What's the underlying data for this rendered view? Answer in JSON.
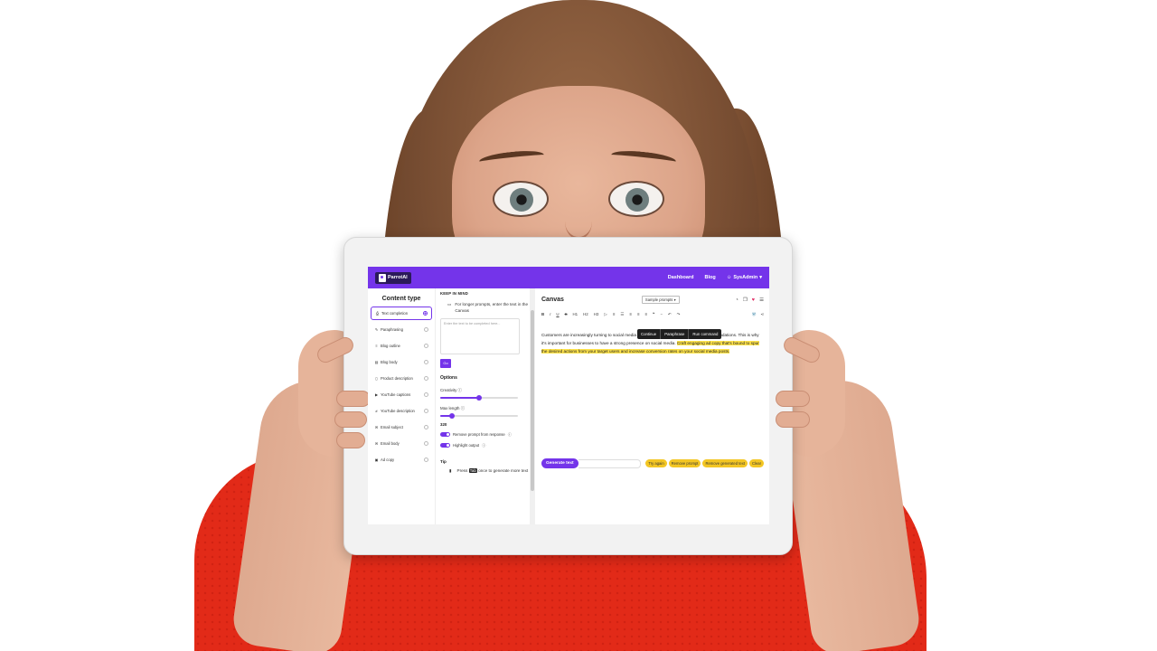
{
  "app": {
    "name": "ParrotAI"
  },
  "nav": {
    "dashboard": "Dashboard",
    "blog": "Blog",
    "user": "SysAdmin"
  },
  "sidebar": {
    "title": "Content type",
    "items": [
      {
        "label": "Text completion",
        "icon": "printer-icon",
        "selected": true
      },
      {
        "label": "Paraphrasing",
        "icon": "edit-icon",
        "selected": false
      },
      {
        "label": "Blog outline",
        "icon": "list-icon",
        "selected": false
      },
      {
        "label": "Blog body",
        "icon": "document-icon",
        "selected": false
      },
      {
        "label": "Product description",
        "icon": "phone-icon",
        "selected": false
      },
      {
        "label": "YouTube captions",
        "icon": "youtube-icon",
        "selected": false
      },
      {
        "label": "YouTube description",
        "icon": "tag-icon",
        "selected": false
      },
      {
        "label": "Email subject",
        "icon": "email-icon",
        "selected": false
      },
      {
        "label": "Email body",
        "icon": "email-icon",
        "selected": false
      },
      {
        "label": "Ad copy",
        "icon": "ad-icon",
        "selected": false
      }
    ]
  },
  "prompt_panel": {
    "keep_in_mind": "KEEP IN MIND",
    "note": "For longer prompts, enter the text in the Canvas",
    "placeholder": "Enter the text to be completed here...",
    "go": "Go",
    "options_title": "Options",
    "creativity_label": "Creativity",
    "creativity_level": 0.5,
    "max_length_label": "Max length",
    "max_length_value": "320",
    "max_length_level": 0.15,
    "toggle_remove_prompt": "Remove prompt from response",
    "toggle_highlight": "Highlight output",
    "tip_title": "Tip",
    "tip_pre": "Press",
    "tip_key": "Tab",
    "tip_post": "once to generate more text"
  },
  "canvas": {
    "title": "Canvas",
    "sample_prompts": "Sample prompts",
    "toolbar": [
      "B",
      "I",
      "U",
      "S",
      "H1",
      "H2",
      "H3",
      "▷",
      "≡",
      "☰",
      "≡",
      "≡",
      "≡",
      "❝",
      "−",
      "↶",
      "↷"
    ],
    "text_plain": "Customers are increasingly turning to social media for their purchasing decisions and recommendations. This is why it's important for businesses to have a strong presence on social media. ",
    "text_highlight": "Craft engaging ad copy that's bound to spur the desired actions from your target users and increase conversion rates on your social media posts.",
    "popup": [
      "Continue",
      "Paraphrase",
      "Run command"
    ],
    "generate": "Generate text",
    "chips": [
      "Try again",
      "Remove prompt",
      "Remove generated text",
      "Clear"
    ]
  },
  "colors": {
    "accent": "#7434ea",
    "highlight": "#ffe44d",
    "chip": "#f3c623"
  }
}
